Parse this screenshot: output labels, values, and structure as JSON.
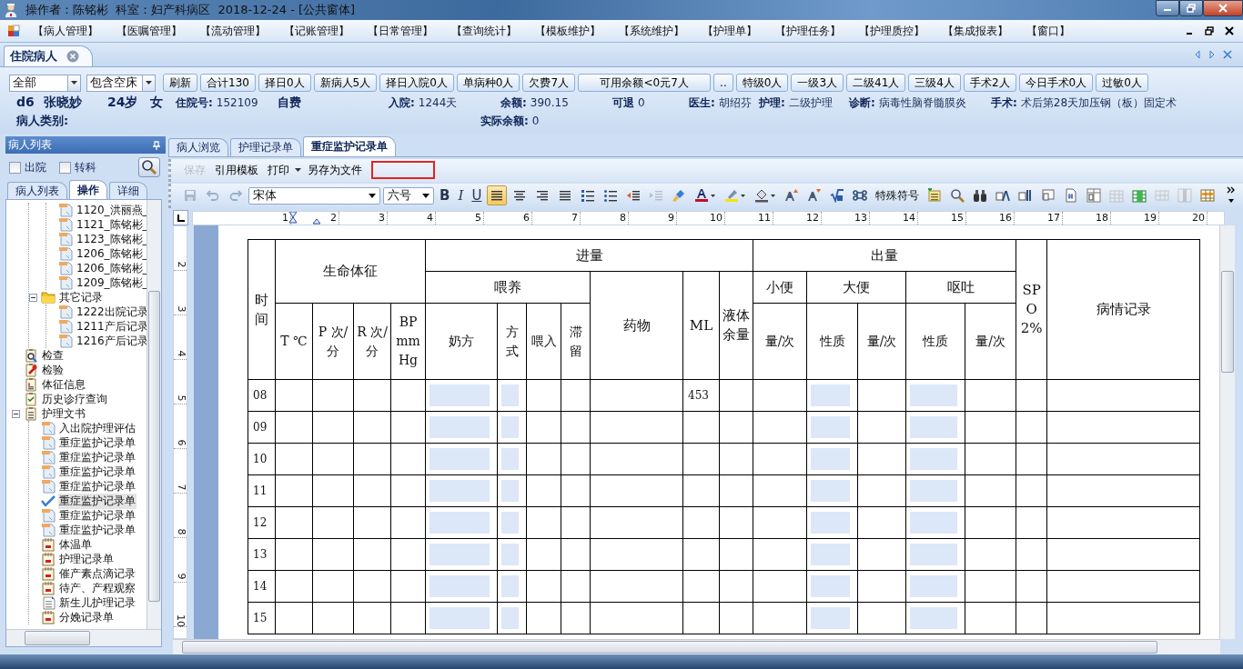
{
  "window": {
    "title": "操作者：陈铭彬  科室：妇产科病区  2018-12-24 - [公共窗体]"
  },
  "menu": [
    "【病人管理】",
    "【医嘱管理】",
    "【流动管理】",
    "【记账管理】",
    "【日常管理】",
    "【查询统计】",
    "【模板维护】",
    "【系统维护】",
    "【护理单】",
    "【护理任务】",
    "【护理质控】",
    "【集成报表】",
    "【窗口】"
  ],
  "doc_tabs": [
    {
      "label": "住院病人",
      "selected": true
    }
  ],
  "filters": {
    "scope": "全部",
    "beds": "包含空床"
  },
  "quick_buttons": [
    "刷新",
    "合计130",
    "择日0人",
    "新病人5人",
    "择日入院0人",
    "单病种0人",
    "欠费7人",
    "可用余额<0元7人",
    "..",
    "特级0人",
    "一级3人",
    "二级41人",
    "三级4人",
    "手术2人",
    "今日手术0人",
    "过敏0人"
  ],
  "patient_rows": [
    [
      {
        "kind": "big",
        "value": "d6"
      },
      {
        "kind": "big",
        "value": "张晓妙"
      },
      {
        "kind": "big",
        "value": "24岁"
      },
      {
        "kind": "big",
        "value": "女"
      },
      {
        "kind": "field",
        "label": "住院号:",
        "value": "152109"
      },
      {
        "kind": "tag",
        "value": "自费"
      },
      {
        "kind": "field",
        "label": "入院:",
        "value": "1244天"
      },
      {
        "kind": "field",
        "label": "余额:",
        "value": "390.15"
      },
      {
        "kind": "field",
        "label": "可退",
        "value": "0"
      },
      {
        "kind": "field",
        "label": "医生:",
        "value": "胡绍芬"
      },
      {
        "kind": "field",
        "label": "护理:",
        "value": "二级护理"
      },
      {
        "kind": "field",
        "label": "诊断:",
        "value": "病毒性脑脊髓膜炎"
      },
      {
        "kind": "field",
        "label": "手术:",
        "value": "术后第28天加压钢（板）固定术"
      }
    ],
    [
      {
        "kind": "tag",
        "value": "病人类别:"
      },
      {
        "kind": "field",
        "label": "实际余额:",
        "value": "0"
      }
    ]
  ],
  "left_panel": {
    "title": "病人列表",
    "checks": [
      {
        "label": "出院",
        "checked": false
      },
      {
        "label": "转科",
        "checked": false
      }
    ],
    "tabs": [
      {
        "label": "病人列表",
        "selected": false
      },
      {
        "label": "操作",
        "selected": true
      },
      {
        "label": "详细",
        "selected": false
      }
    ],
    "tree": [
      {
        "kind": "offscreen",
        "children": [
          {
            "kind": "offscreen",
            "children": [
              {
                "kind": "doc",
                "label": "1120_洪丽燕_",
                "selected": false
              },
              {
                "kind": "doc",
                "label": "1121_陈铭彬_",
                "selected": false
              },
              {
                "kind": "doc",
                "label": "1123_陈铭彬_",
                "selected": false
              },
              {
                "kind": "doc",
                "label": "1206_陈铭彬_",
                "selected": false
              },
              {
                "kind": "doc",
                "label": "1206_陈铭彬_",
                "selected": false
              },
              {
                "kind": "doc",
                "label": "1209_陈铭彬_",
                "selected": false
              }
            ]
          },
          {
            "kind": "folder",
            "label": "其它记录",
            "selected": false,
            "expanded": true,
            "children": [
              {
                "kind": "doc",
                "label": "1222出院记录",
                "selected": false
              },
              {
                "kind": "doc",
                "label": "1211产后记录",
                "selected": false
              },
              {
                "kind": "doc",
                "label": "1216产后记录",
                "selected": false
              }
            ]
          }
        ]
      },
      {
        "kind": "exam",
        "label": "检查",
        "selected": false
      },
      {
        "kind": "lab",
        "label": "检验",
        "selected": false
      },
      {
        "kind": "vitals",
        "label": "体征信息",
        "selected": false
      },
      {
        "kind": "history",
        "label": "历史诊疗查询",
        "selected": false
      },
      {
        "kind": "clipboard",
        "label": "护理文书",
        "selected": false,
        "expanded": true,
        "children": [
          {
            "kind": "doc",
            "label": "入出院护理评估",
            "selected": false
          },
          {
            "kind": "doc",
            "label": "重症监护记录单",
            "selected": false
          },
          {
            "kind": "doc",
            "label": "重症监护记录单",
            "selected": false
          },
          {
            "kind": "doc",
            "label": "重症监护记录单",
            "selected": false
          },
          {
            "kind": "doc",
            "label": "重症监护记录单",
            "selected": false
          },
          {
            "kind": "check",
            "label": "重症监护记录单",
            "selected": true
          },
          {
            "kind": "doc",
            "label": "重症监护记录单",
            "selected": false
          },
          {
            "kind": "doc",
            "label": "重症监护记录单",
            "selected": false
          },
          {
            "kind": "chart",
            "label": "体温单",
            "selected": false
          },
          {
            "kind": "chart",
            "label": "护理记录单",
            "selected": false
          },
          {
            "kind": "chart",
            "label": "催产素点滴记录",
            "selected": false
          },
          {
            "kind": "chart",
            "label": "待产、产程观察",
            "selected": false
          },
          {
            "kind": "page",
            "label": "新生儿护理记录",
            "selected": false
          },
          {
            "kind": "chart",
            "label": "分娩记录单",
            "selected": false
          }
        ]
      }
    ]
  },
  "record_tabs": [
    {
      "label": "病人浏览",
      "selected": false
    },
    {
      "label": "护理记录单",
      "selected": false
    },
    {
      "label": "重症监护记录单",
      "selected": true
    }
  ],
  "record_toolbar": [
    {
      "kind": "button",
      "label": "保存",
      "disabled": true
    },
    {
      "kind": "button",
      "label": "引用模板",
      "disabled": false
    },
    {
      "kind": "menu",
      "label": "打印",
      "disabled": false
    },
    {
      "kind": "button",
      "label": "另存为文件",
      "disabled": false
    },
    {
      "kind": "marker"
    }
  ],
  "format_toolbar": [
    {
      "kind": "save",
      "disabled": true
    },
    {
      "kind": "undo",
      "disabled": true
    },
    {
      "kind": "redo",
      "disabled": true
    },
    {
      "kind": "font",
      "value": "宋体",
      "disabled": false
    },
    {
      "kind": "size",
      "value": "六号",
      "disabled": false
    },
    {
      "kind": "bold",
      "label": "B",
      "disabled": false
    },
    {
      "kind": "italic",
      "label": "I",
      "disabled": false
    },
    {
      "kind": "underline",
      "label": "U",
      "disabled": false
    },
    {
      "kind": "align-left",
      "selected": true,
      "disabled": false
    },
    {
      "kind": "align-center",
      "selected": false,
      "disabled": false
    },
    {
      "kind": "align-right",
      "selected": false,
      "disabled": false
    },
    {
      "kind": "justify",
      "selected": false,
      "disabled": false
    },
    {
      "kind": "numbered-list",
      "disabled": false
    },
    {
      "kind": "bullet-list",
      "disabled": false
    },
    {
      "kind": "outdent",
      "disabled": false
    },
    {
      "kind": "indent",
      "disabled": true
    },
    {
      "kind": "brush",
      "disabled": false
    },
    {
      "kind": "font-color",
      "disabled": false
    },
    {
      "kind": "highlight",
      "disabled": false
    },
    {
      "kind": "shading",
      "disabled": false
    },
    {
      "kind": "grow-font",
      "disabled": false
    },
    {
      "kind": "shrink-font",
      "disabled": false
    },
    {
      "kind": "formula",
      "disabled": false
    },
    {
      "kind": "knot",
      "disabled": false
    },
    {
      "kind": "symbols",
      "label": "特殊符号",
      "disabled": false
    },
    {
      "kind": "note",
      "disabled": false
    },
    {
      "kind": "search",
      "disabled": false
    },
    {
      "kind": "binoculars",
      "disabled": false
    },
    {
      "kind": "field-a",
      "disabled": false
    },
    {
      "kind": "field-b",
      "disabled": false
    },
    {
      "kind": "field-c",
      "disabled": false
    },
    {
      "kind": "page-number",
      "disabled": false
    },
    {
      "kind": "table-field",
      "disabled": false
    },
    {
      "kind": "table-insert",
      "disabled": true
    },
    {
      "kind": "table-add",
      "disabled": false
    },
    {
      "kind": "table-rows",
      "disabled": true
    },
    {
      "kind": "table-cols",
      "disabled": true
    },
    {
      "kind": "table-header",
      "disabled": false
    }
  ],
  "ruler": {
    "h_marks": [
      "1",
      "2",
      "3",
      "4",
      "5",
      "6",
      "7",
      "8",
      "9",
      "10",
      "11",
      "12",
      "13",
      "14",
      "15",
      "16",
      "17",
      "18",
      "19",
      "20"
    ],
    "v_marks": [
      "2",
      "3",
      "4",
      "5",
      "6",
      "7",
      "8",
      "9",
      "10"
    ]
  },
  "form": {
    "header_rows": [
      [
        {
          "text": "时间",
          "rowspan": 3
        },
        {
          "text": "生命体征",
          "colspan": 4,
          "rowspan": 2
        },
        {
          "text": "进量",
          "colspan": 7
        },
        {
          "text": "出量",
          "colspan": 5
        },
        {
          "text": "SPO2%",
          "rowspan": 3
        },
        {
          "text": "病情记录",
          "rowspan": 3
        }
      ],
      [
        {
          "text": "喂养",
          "colspan": 4
        },
        {
          "text": "药物",
          "rowspan": 2
        },
        {
          "text": "ML",
          "rowspan": 2
        },
        {
          "text": "液体余量",
          "rowspan": 2
        },
        {
          "text": "小便"
        },
        {
          "text": "大便",
          "colspan": 2
        },
        {
          "text": "呕吐",
          "colspan": 2
        }
      ],
      [
        {
          "text": "T ℃"
        },
        {
          "text": "P 次/分"
        },
        {
          "text": "R 次/分"
        },
        {
          "text": "BP mmHg"
        },
        {
          "text": "奶方"
        },
        {
          "text": "方式"
        },
        {
          "text": "喂入"
        },
        {
          "text": "滞留"
        },
        {
          "text": "量/次"
        },
        {
          "text": "性质"
        },
        {
          "text": "量/次"
        },
        {
          "text": "性质"
        },
        {
          "text": "量/次"
        }
      ]
    ],
    "data_columns": [
      {
        "kind": "text"
      },
      {
        "kind": "text"
      },
      {
        "kind": "text"
      },
      {
        "kind": "text"
      },
      {
        "kind": "text"
      },
      {
        "kind": "input"
      },
      {
        "kind": "input"
      },
      {
        "kind": "text"
      },
      {
        "kind": "text"
      },
      {
        "kind": "text"
      },
      {
        "kind": "text"
      },
      {
        "kind": "text"
      },
      {
        "kind": "text"
      },
      {
        "kind": "input"
      },
      {
        "kind": "text"
      },
      {
        "kind": "input"
      },
      {
        "kind": "text"
      },
      {
        "kind": "text"
      },
      {
        "kind": "text"
      }
    ],
    "rows": [
      {
        "time": "08",
        "ml": "453"
      },
      {
        "time": "09"
      },
      {
        "time": "10"
      },
      {
        "time": "11"
      },
      {
        "time": "12"
      },
      {
        "time": "13"
      },
      {
        "time": "14"
      },
      {
        "time": "15"
      }
    ]
  }
}
